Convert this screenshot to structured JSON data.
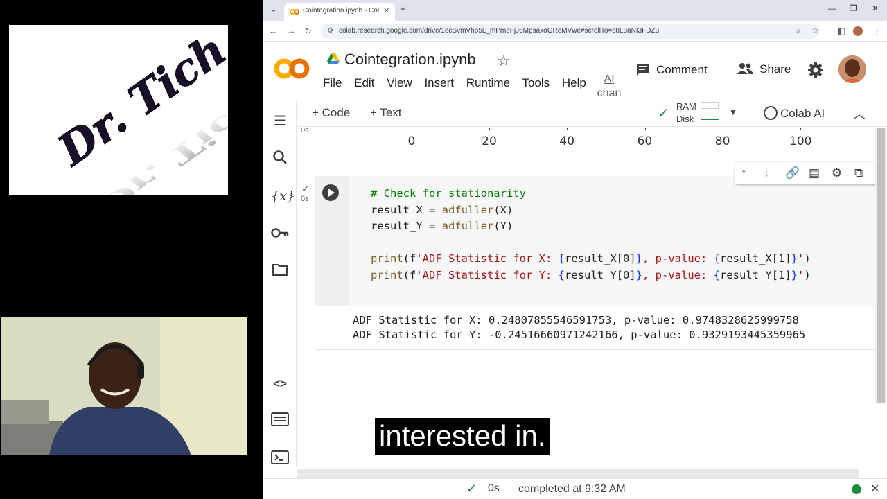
{
  "browser": {
    "tab_title": "Cointegration.ipynb - Colabora",
    "url": "colab.research.google.com/drive/1ecSvmVhp5L_mPmeFjJ6MpsaxoGReMVwe#scrollTo=c8L8aNI3FDZu"
  },
  "header": {
    "title": "Cointegration.ipynb",
    "menu": [
      "File",
      "Edit",
      "View",
      "Insert",
      "Runtime",
      "Tools",
      "Help"
    ],
    "ai_change_line1": "AI",
    "ai_change_line2": "chan",
    "comment_label": "Comment",
    "share_label": "Share"
  },
  "toolbar": {
    "add_code_label": "+ Code",
    "add_text_label": "+ Text",
    "ram_label": "RAM",
    "disk_label": "Disk",
    "colab_ai_label": "Colab AI"
  },
  "prev_plot": {
    "x_ticks": [
      "0",
      "20",
      "40",
      "60",
      "80",
      "100"
    ],
    "exec_time": "0s"
  },
  "cell": {
    "exec_time": "0s",
    "code_lines": [
      "# Check for stationarity",
      "result_X = adfuller(X)",
      "result_Y = adfuller(Y)",
      "",
      "print(f'ADF Statistic for X: {result_X[0]}, p-value: {result_X[1]}')",
      "print(f'ADF Statistic for Y: {result_Y[0]}, p-value: {result_Y[1]}')"
    ],
    "output_lines": [
      "ADF Statistic for X: 0.24807855546591753, p-value: 0.9748328625999758",
      "ADF Statistic for Y: -0.24516660971242166, p-value: 0.9329193445359965"
    ]
  },
  "subtitle": "interested in.",
  "status": {
    "time": "0s",
    "text": "completed at 9:32 AM"
  },
  "colors": {
    "colab_orange": "#f9ab00",
    "success_green": "#188038"
  }
}
